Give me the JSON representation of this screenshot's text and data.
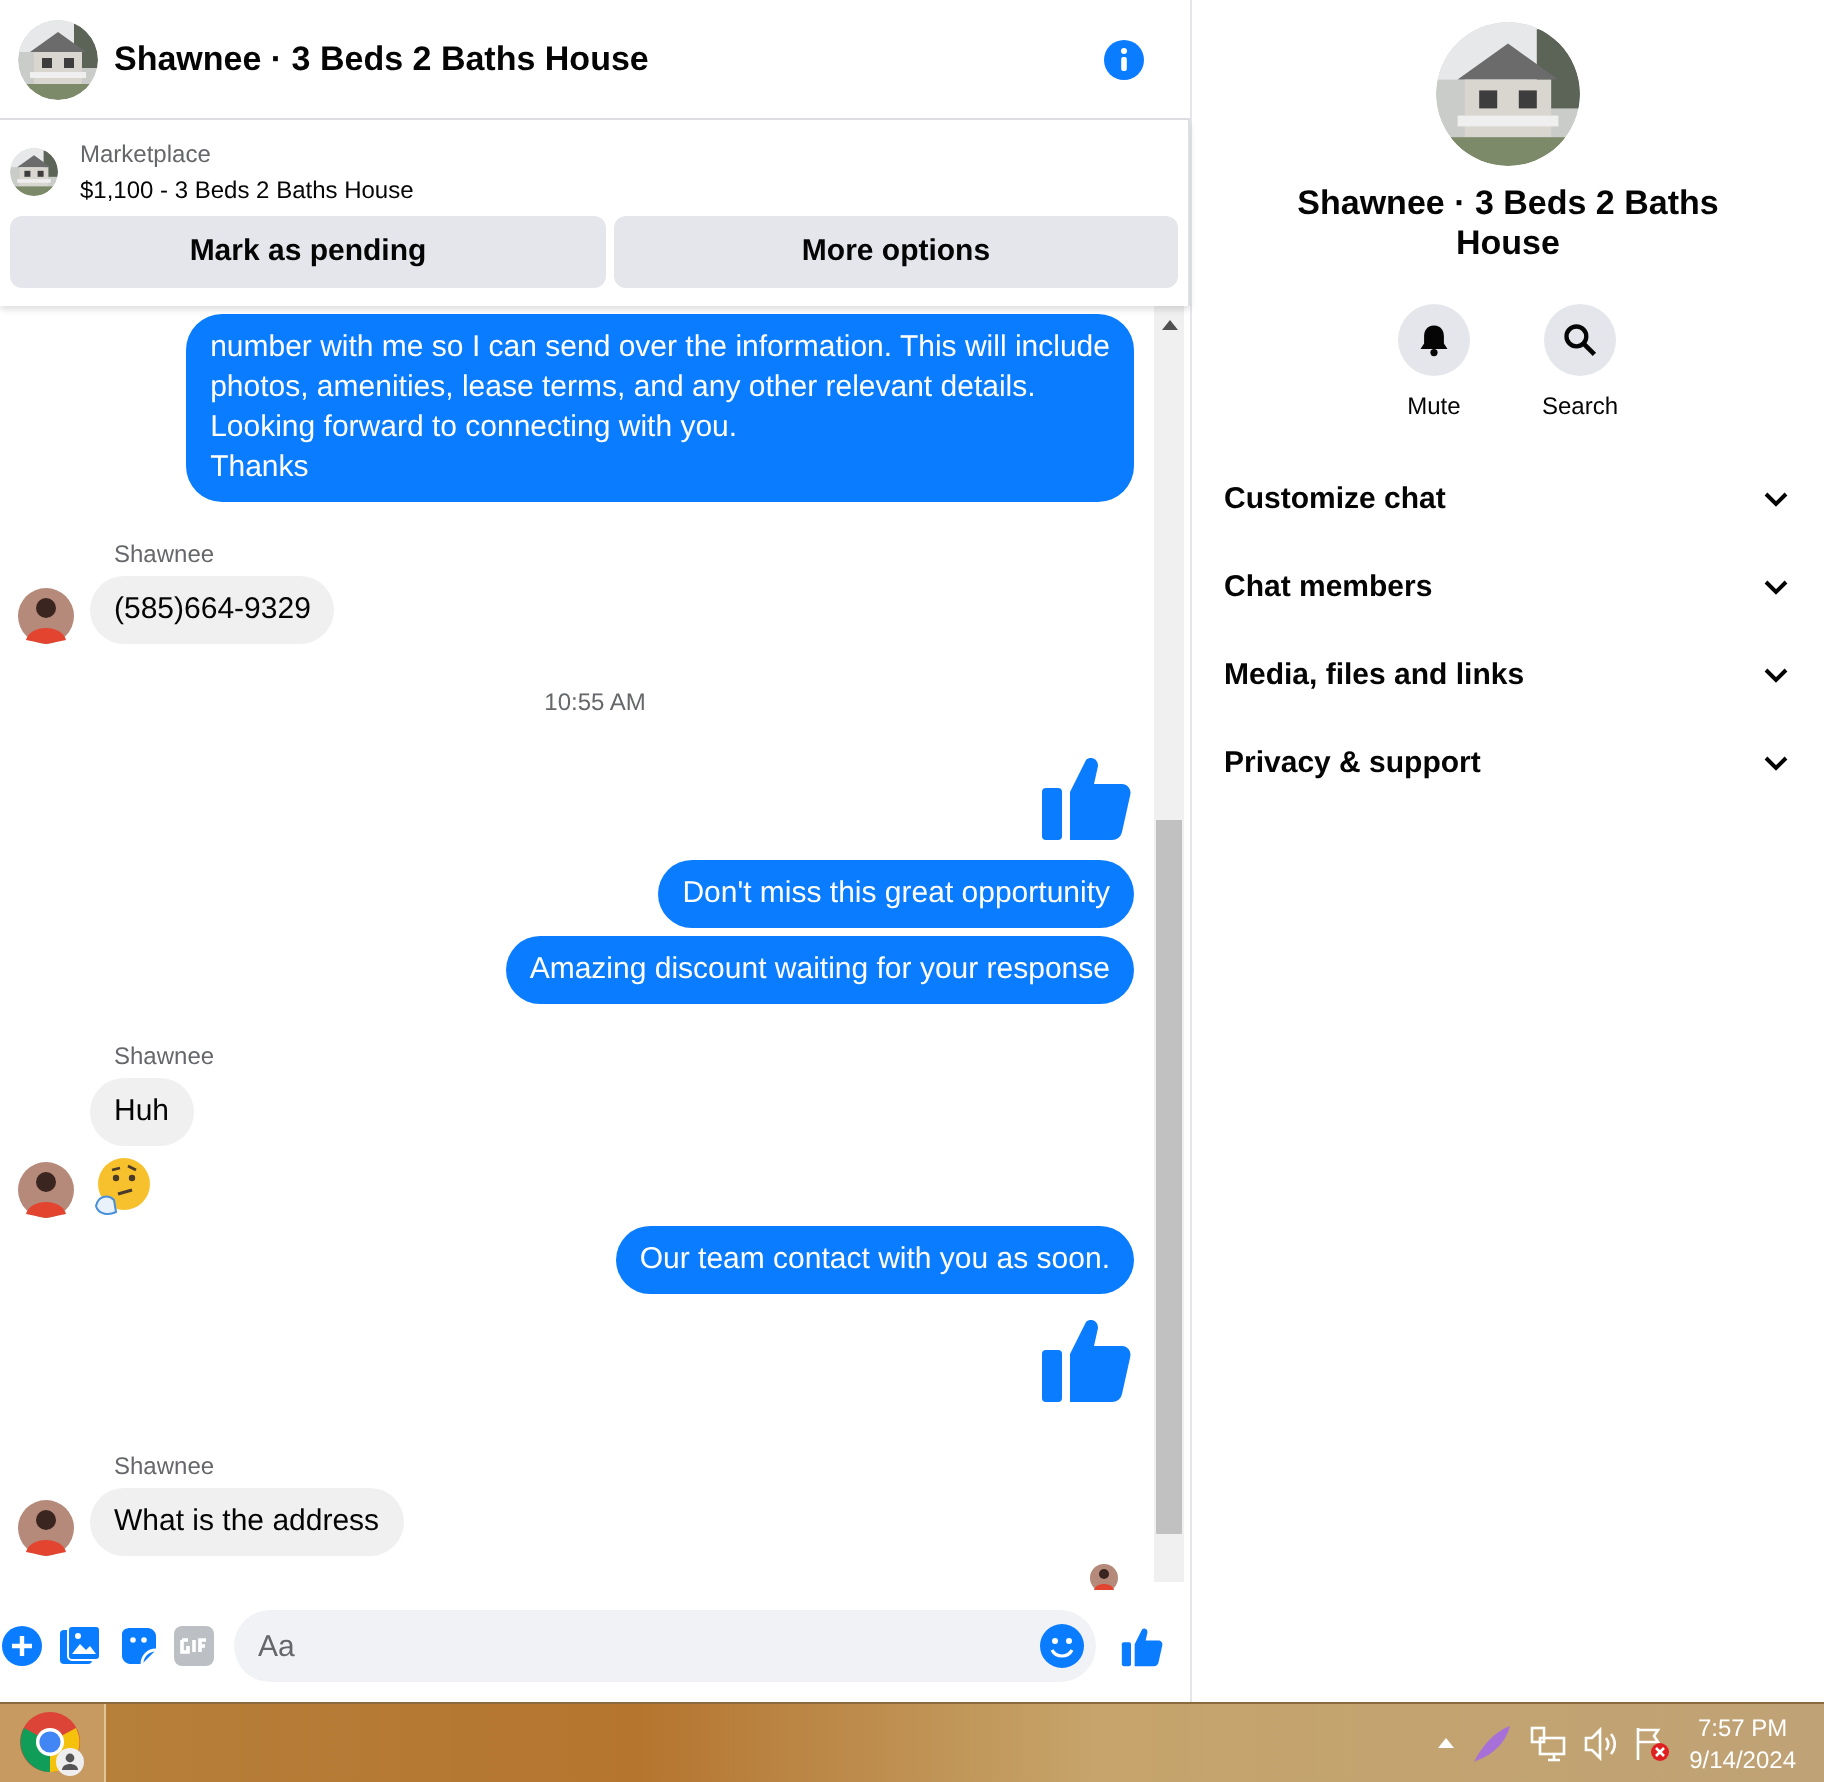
{
  "header": {
    "title": "Shawnee · 3 Beds 2 Baths House"
  },
  "listing": {
    "label": "Marketplace",
    "title": "$1,100 - 3 Beds 2 Baths House",
    "actions": [
      "Mark as pending",
      "More options"
    ]
  },
  "messages": [
    {
      "kind": "out",
      "lines": [
        "number with me so I can send over the information. This will include",
        "photos, amenities, lease terms, and any other relevant details.",
        "Looking forward to connecting with you.",
        "Thanks"
      ]
    },
    {
      "kind": "sender",
      "text": "Shawnee"
    },
    {
      "kind": "in",
      "text": "(585)664-9329",
      "avatar": true
    },
    {
      "kind": "time",
      "text": "10:55 AM"
    },
    {
      "kind": "like"
    },
    {
      "kind": "out",
      "lines": [
        "Don't miss this great opportunity"
      ]
    },
    {
      "kind": "out",
      "lines": [
        "Amazing discount waiting for your response"
      ]
    },
    {
      "kind": "sender",
      "text": "Shawnee"
    },
    {
      "kind": "in",
      "text": "Huh",
      "avatar": false
    },
    {
      "kind": "emoji"
    },
    {
      "kind": "out",
      "lines": [
        "Our team contact with you as soon."
      ]
    },
    {
      "kind": "like"
    },
    {
      "kind": "sender",
      "text": "Shawnee"
    },
    {
      "kind": "in",
      "text": "What is the address",
      "avatar": true
    },
    {
      "kind": "seen"
    }
  ],
  "composer": {
    "placeholder": "Aa"
  },
  "details": {
    "title": "Shawnee · 3 Beds 2 Baths House",
    "actions": [
      {
        "kind": "mute",
        "label": "Mute"
      },
      {
        "kind": "search",
        "label": "Search"
      }
    ],
    "sections": [
      {
        "label": "Customize chat",
        "expanded": false
      },
      {
        "label": "Chat members",
        "expanded": false
      },
      {
        "label": "Media, files and links",
        "expanded": false
      },
      {
        "label": "Privacy & support",
        "expanded": false
      }
    ]
  },
  "taskbar": {
    "time": "7:57 PM",
    "date": "9/14/2024"
  }
}
